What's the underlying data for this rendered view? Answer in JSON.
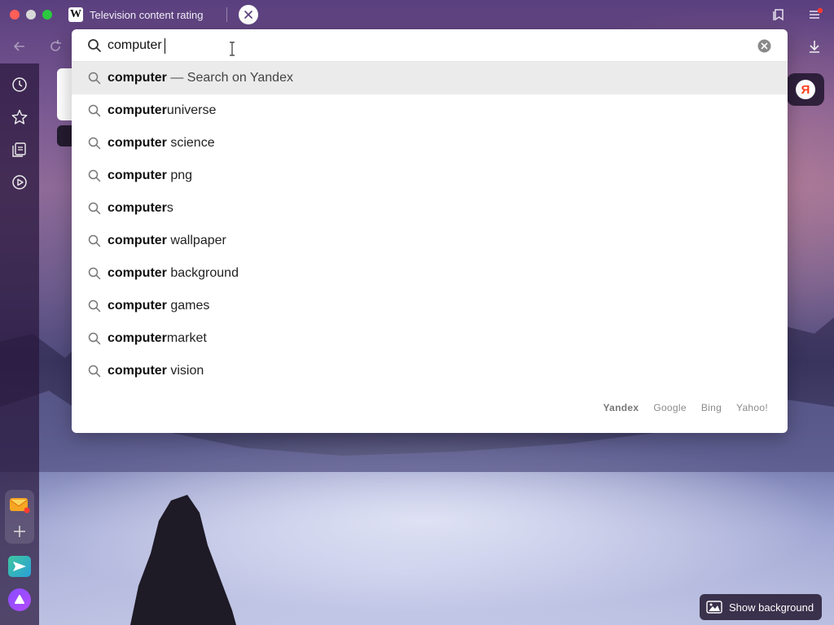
{
  "browser": {
    "tab_title": "Television content rating",
    "tab_favicon_letter": "W"
  },
  "omnibox": {
    "query": "computer",
    "suggestions": [
      {
        "bold": "computer",
        "rest": " — Search on Yandex"
      },
      {
        "bold": "computer",
        "rest": "universe"
      },
      {
        "bold": "computer",
        "rest": " science"
      },
      {
        "bold": "computer",
        "rest": " png"
      },
      {
        "bold": "computer",
        "rest": "s"
      },
      {
        "bold": "computer",
        "rest": " wallpaper"
      },
      {
        "bold": "computer",
        "rest": " background"
      },
      {
        "bold": "computer",
        "rest": " games"
      },
      {
        "bold": "computer",
        "rest": "market"
      },
      {
        "bold": "computer",
        "rest": " vision"
      }
    ],
    "engines": [
      "Yandex",
      "Google",
      "Bing",
      "Yahoo!"
    ],
    "selected_engine": "Yandex"
  },
  "yandex_badge_letter": "Я",
  "show_background_label": "Show background",
  "icons": {
    "sidebar": [
      "history-icon",
      "bookmarks-star-icon",
      "collections-icon",
      "video-play-icon"
    ],
    "bottom": [
      "mail-icon",
      "add-icon",
      "messenger-icon",
      "alice-icon"
    ]
  },
  "colors": {
    "accent_red": "#ff5f57",
    "yandex_red": "#fc3f1d",
    "suggest_highlight": "#ebebeb"
  }
}
